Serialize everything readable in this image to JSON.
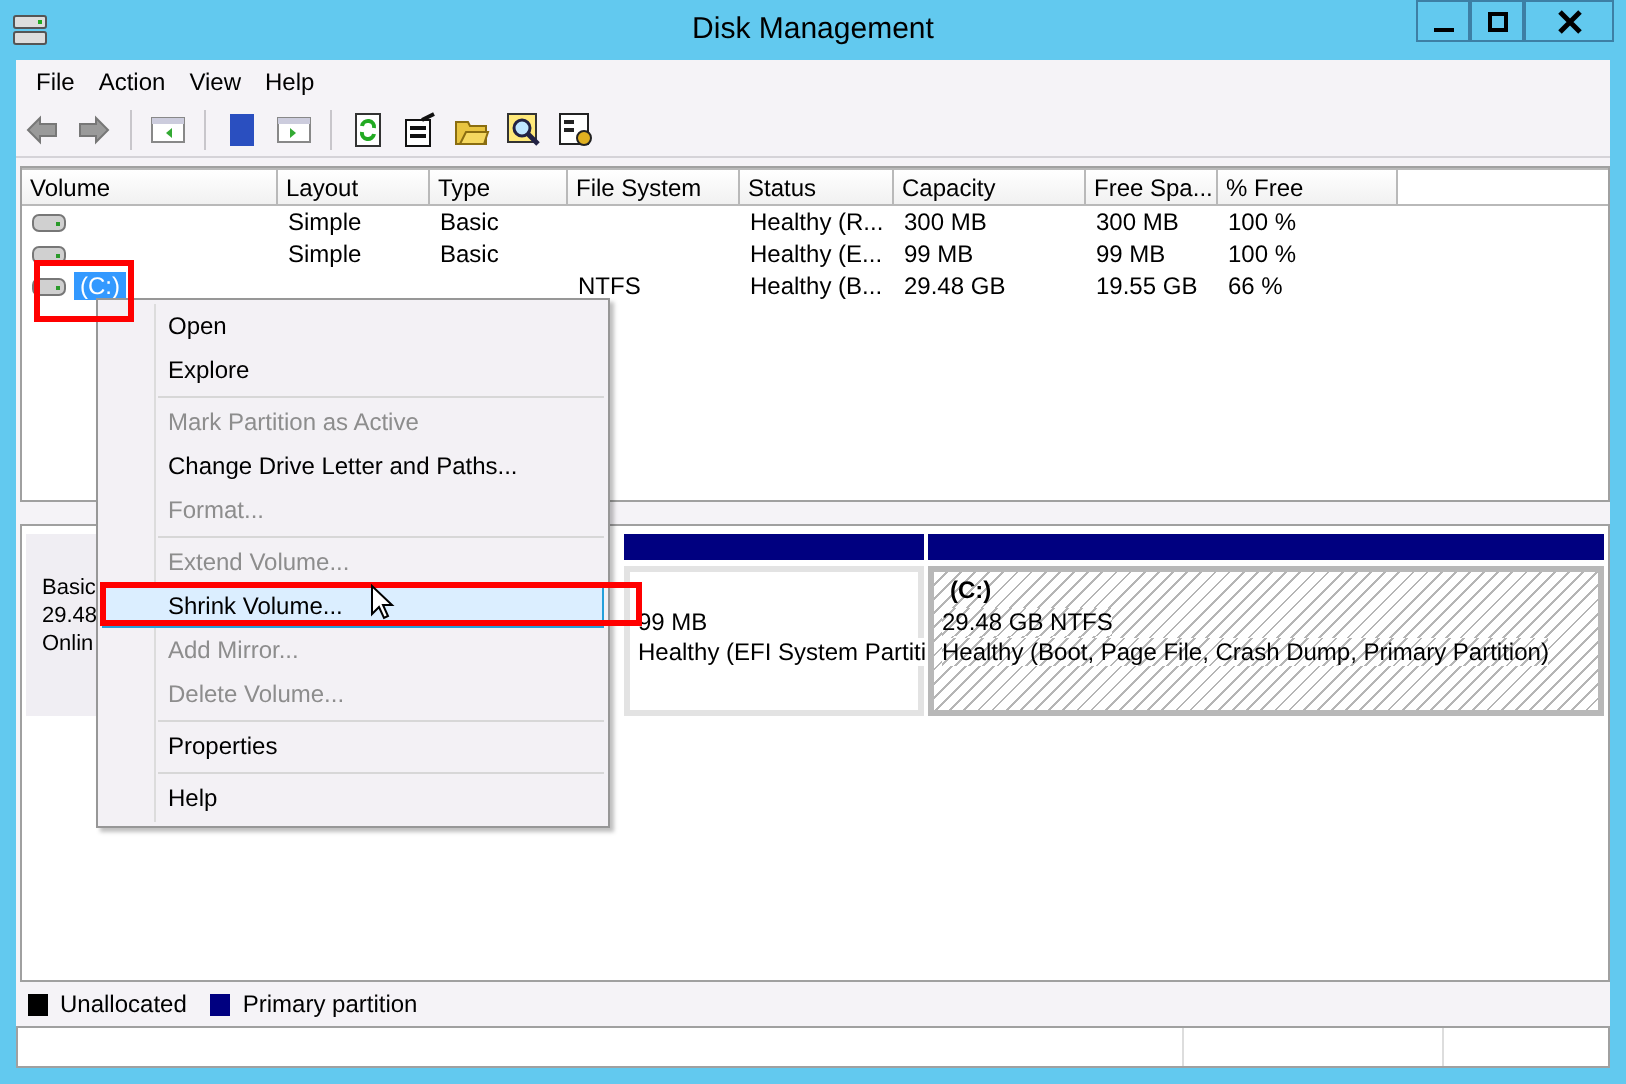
{
  "window": {
    "title": "Disk Management"
  },
  "menu_bar": [
    "File",
    "Action",
    "View",
    "Help"
  ],
  "volume_list": {
    "columns": [
      "Volume",
      "Layout",
      "Type",
      "File System",
      "Status",
      "Capacity",
      "Free Spa...",
      "% Free"
    ],
    "rows": [
      {
        "selected": false,
        "layout": "Simple",
        "type": "Basic",
        "status": "Healthy (R...",
        "capacity": "300 MB",
        "free_space": "300 MB",
        "percent_free": "100 %"
      },
      {
        "selected": false,
        "layout": "Simple",
        "type": "Basic",
        "status": "Healthy (E...",
        "capacity": "99 MB",
        "free_space": "99 MB",
        "percent_free": "100 %"
      },
      {
        "selected": true,
        "volume": "(C:)",
        "file_system": "NTFS",
        "status": "Healthy (B...",
        "capacity": "29.48 GB",
        "free_space": "19.55 GB",
        "percent_free": "66 %"
      }
    ]
  },
  "disk_map": {
    "disk_lines": [
      "Basic",
      "29.48",
      "Onlin"
    ],
    "partitions": [
      {
        "kind": "plain",
        "size": "99 MB",
        "status": "Healthy (EFI System Partiti"
      },
      {
        "kind": "hatched",
        "name": "(C:)",
        "size": "29.48 GB NTFS",
        "status": "Healthy (Boot, Page File, Crash Dump, Primary Partition)"
      }
    ]
  },
  "legend": [
    {
      "label": "Unallocated",
      "color": "#000000"
    },
    {
      "label": "Primary partition",
      "color": "#000080"
    }
  ],
  "context_menu": {
    "items": [
      {
        "kind": "item",
        "label": "Open",
        "disabled": false,
        "selected": false
      },
      {
        "kind": "item",
        "label": "Explore",
        "disabled": false,
        "selected": false
      },
      {
        "kind": "separator"
      },
      {
        "kind": "item",
        "label": "Mark Partition as Active",
        "disabled": true,
        "selected": false
      },
      {
        "kind": "item",
        "label": "Change Drive Letter and Paths...",
        "disabled": false,
        "selected": false
      },
      {
        "kind": "item",
        "label": "Format...",
        "disabled": true,
        "selected": false
      },
      {
        "kind": "separator"
      },
      {
        "kind": "item",
        "label": "Extend Volume...",
        "disabled": true,
        "selected": false
      },
      {
        "kind": "item",
        "label": "Shrink Volume...",
        "disabled": false,
        "selected": true
      },
      {
        "kind": "item",
        "label": "Add Mirror...",
        "disabled": true,
        "selected": false
      },
      {
        "kind": "item",
        "label": "Delete Volume...",
        "disabled": true,
        "selected": false
      },
      {
        "kind": "separator"
      },
      {
        "kind": "item",
        "label": "Properties",
        "disabled": false,
        "selected": false
      },
      {
        "kind": "separator"
      },
      {
        "kind": "item",
        "label": "Help",
        "disabled": false,
        "selected": false
      }
    ]
  }
}
